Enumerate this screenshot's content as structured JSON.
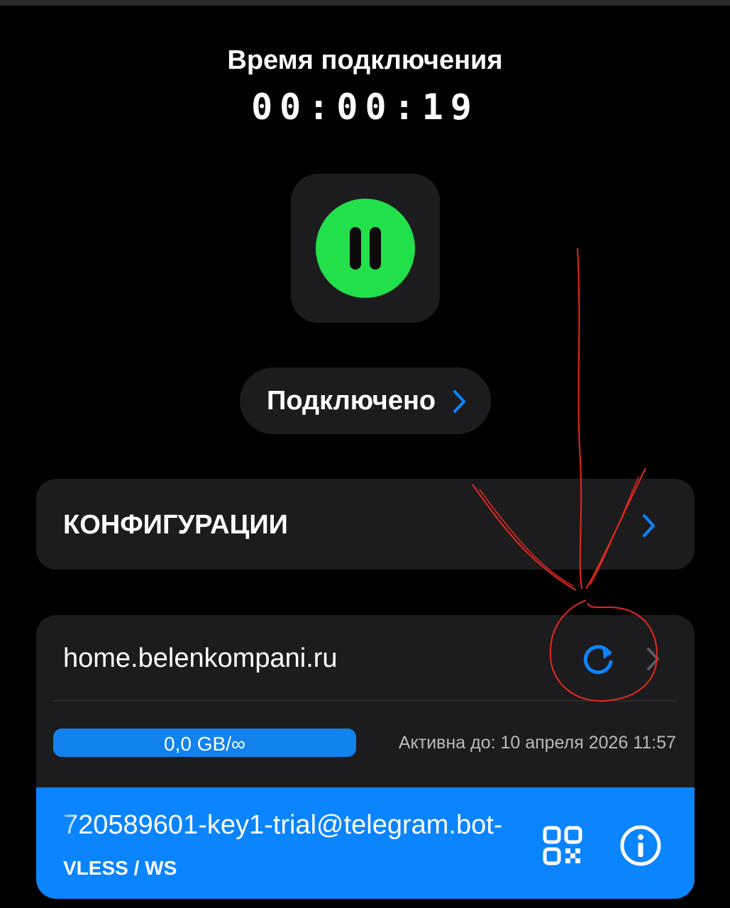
{
  "timer": {
    "title": "Время подключения",
    "value": "00:00:19"
  },
  "connection": {
    "state": "paused-toggle",
    "status_label": "Подключено"
  },
  "configs": {
    "label": "КОНФИГУРАЦИИ"
  },
  "server": {
    "name": "home.belenkompani.ru",
    "traffic_used_fraction": 0.0,
    "traffic_label": "0,0 GB/∞",
    "active_until": "Активна до: 10 апреля 2026 11:57",
    "key": {
      "id": "720589601-key1-trial@telegram.bot-",
      "protocol": "VLESS / WS"
    }
  },
  "icons": {
    "pause": "pause-icon",
    "chevron": "chevron-right-icon",
    "refresh": "refresh-icon",
    "qr": "qr-code-icon",
    "info": "info-icon"
  },
  "colors": {
    "background": "#000000",
    "card": "#1c1c1e",
    "accent": "#0a84ff",
    "connected": "#22e04a",
    "annotation": "#e8281e"
  }
}
